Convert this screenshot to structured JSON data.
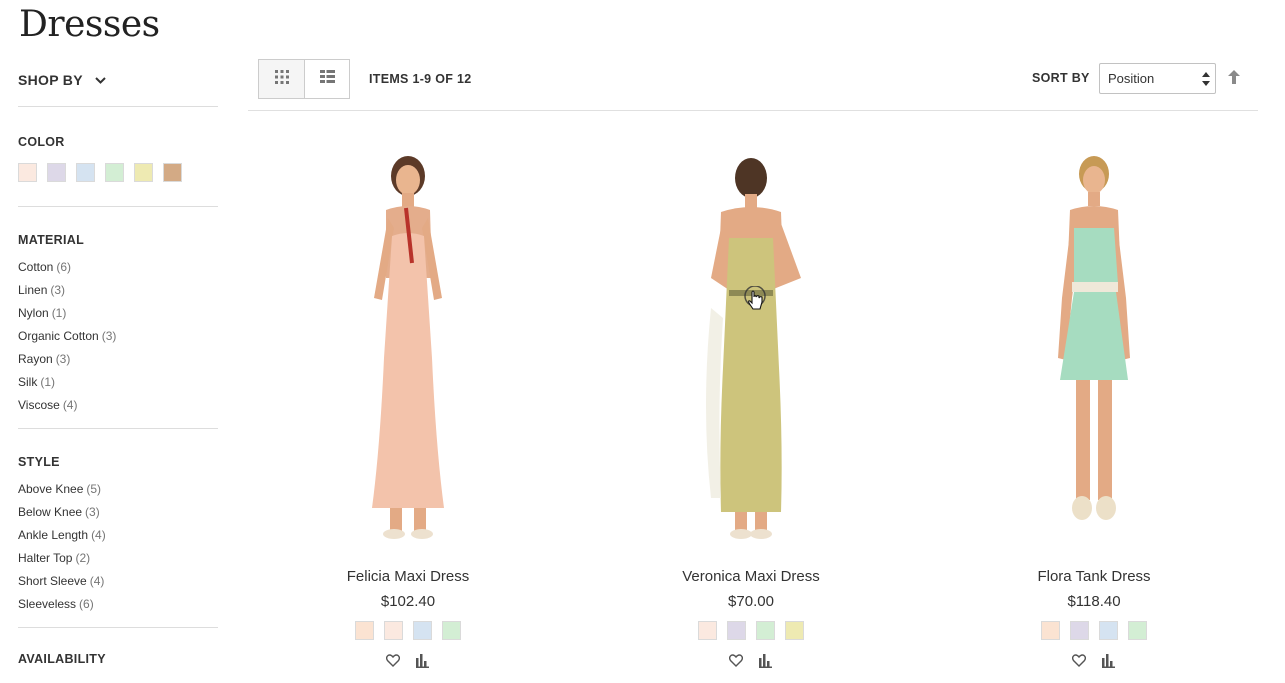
{
  "page": {
    "title": "Dresses"
  },
  "sidebar": {
    "shop_by": "SHOP BY",
    "color": {
      "title": "COLOR",
      "swatches": [
        "#fbe9e0",
        "#ddd8e8",
        "#d5e3f1",
        "#d3eed4",
        "#eeeab2",
        "#d3aa85"
      ]
    },
    "material": {
      "title": "MATERIAL",
      "items": [
        {
          "label": "Cotton",
          "count": "(6)"
        },
        {
          "label": "Linen",
          "count": "(3)"
        },
        {
          "label": "Nylon",
          "count": "(1)"
        },
        {
          "label": "Organic Cotton",
          "count": "(3)"
        },
        {
          "label": "Rayon",
          "count": "(3)"
        },
        {
          "label": "Silk",
          "count": "(1)"
        },
        {
          "label": "Viscose",
          "count": "(4)"
        }
      ]
    },
    "style": {
      "title": "STYLE",
      "items": [
        {
          "label": "Above Knee",
          "count": "(5)"
        },
        {
          "label": "Below Knee",
          "count": "(3)"
        },
        {
          "label": "Ankle Length",
          "count": "(4)"
        },
        {
          "label": "Halter Top",
          "count": "(2)"
        },
        {
          "label": "Short Sleeve",
          "count": "(4)"
        },
        {
          "label": "Sleeveless",
          "count": "(6)"
        }
      ]
    },
    "availability": {
      "title": "AVAILABILITY"
    }
  },
  "toolbar": {
    "modes": [
      {
        "icon": "grid-icon",
        "active": true
      },
      {
        "icon": "list-icon",
        "active": false
      }
    ],
    "amount": "ITEMS 1-9 OF 12",
    "sort_label": "SORT BY",
    "sort_value": "Position",
    "sort_direction_icon": "arrow-up-icon"
  },
  "products": [
    {
      "name": "Felicia Maxi Dress",
      "price": "$102.40",
      "dress_color": "#f3c3ab",
      "swatches": [
        "#fbe3d2",
        "#fbe9e0",
        "#d5e3f1",
        "#d3eed4"
      ]
    },
    {
      "name": "Veronica Maxi Dress",
      "price": "$70.00",
      "dress_color": "#cdc47c",
      "swatches": [
        "#fbe9e0",
        "#ddd8e8",
        "#d3eed4",
        "#eeeab2"
      ]
    },
    {
      "name": "Flora Tank Dress",
      "price": "$118.40",
      "dress_color": "#a6dcc0",
      "swatches": [
        "#fbe3d2",
        "#ddd8e8",
        "#d5e3f1",
        "#d3eed4"
      ]
    }
  ],
  "icons": {
    "wishlist": "heart-icon",
    "compare": "bar-chart-icon",
    "pointer": "hand-pointer-icon"
  }
}
